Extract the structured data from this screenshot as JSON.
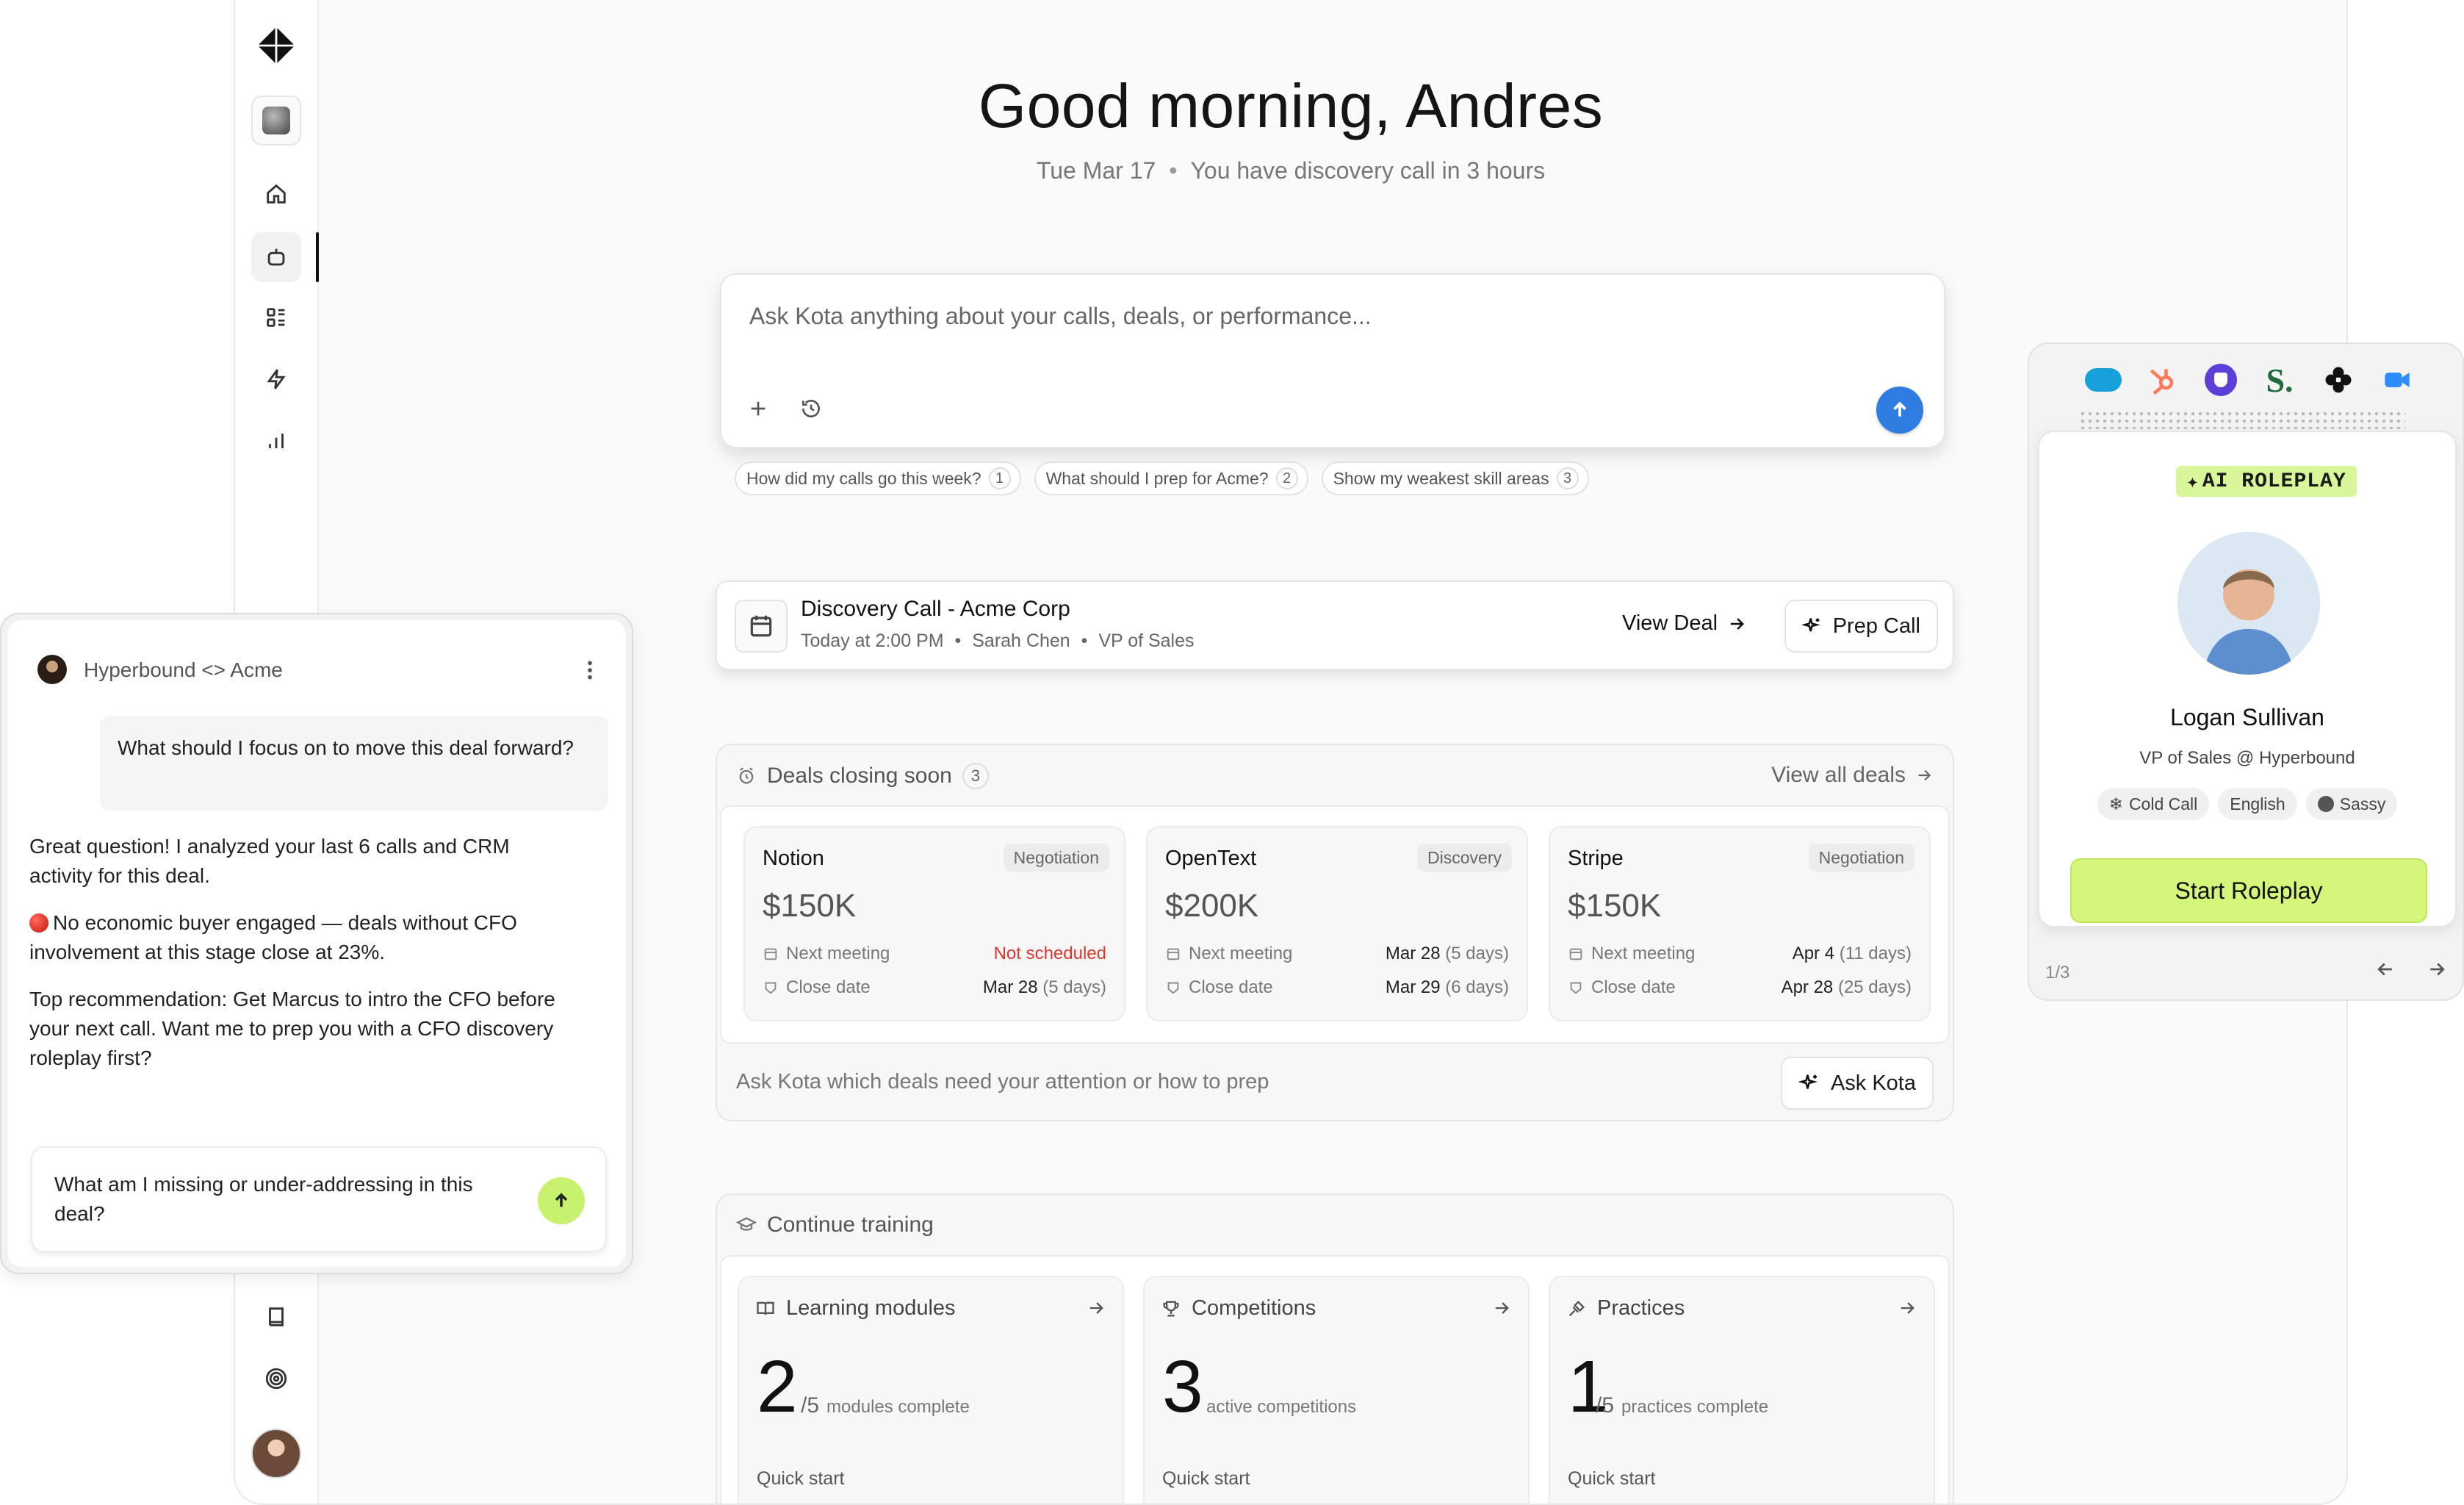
{
  "greeting": "Good morning, Andres",
  "subline": {
    "date": "Tue Mar 17",
    "note": "You have discovery call in 3 hours"
  },
  "ask": {
    "placeholder": "Ask Kota anything about your calls, deals, or performance..."
  },
  "suggestions": [
    {
      "label": "How did my calls go this week?",
      "num": "1"
    },
    {
      "label": "What should I prep for Acme?",
      "num": "2"
    },
    {
      "label": "Show my weakest skill areas",
      "num": "3"
    }
  ],
  "meeting": {
    "title": "Discovery Call - Acme Corp",
    "time": "Today at 2:00 PM",
    "person": "Sarah Chen",
    "role": "VP of Sales",
    "view_label": "View Deal",
    "prep_label": "Prep Call"
  },
  "deals": {
    "title": "Deals closing soon",
    "count": "3",
    "view_all": "View all deals",
    "footer": "Ask Kota which deals need your attention or how to prep",
    "ask_label": "Ask Kota",
    "next_label": "Next meeting",
    "close_label": "Close date",
    "items": [
      {
        "name": "Notion",
        "stage": "Negotiation",
        "amount": "$150K",
        "next": "Not scheduled",
        "next_rel": "",
        "close": "Mar 28",
        "close_rel": "(5 days)"
      },
      {
        "name": "OpenText",
        "stage": "Discovery",
        "amount": "$200K",
        "next": "Mar 28",
        "next_rel": "(5 days)",
        "close": "Mar 29",
        "close_rel": "(6 days)"
      },
      {
        "name": "Stripe",
        "stage": "Negotiation",
        "amount": "$150K",
        "next": "Apr 4",
        "next_rel": "(11 days)",
        "close": "Apr 28",
        "close_rel": "(25 days)"
      }
    ]
  },
  "training": {
    "title": "Continue training",
    "quick_start": "Quick start",
    "cards": [
      {
        "title": "Learning modules",
        "big": "2",
        "of": "/5",
        "desc": "modules complete"
      },
      {
        "title": "Competitions",
        "big": "3",
        "of": "",
        "desc": "active competitions"
      },
      {
        "title": "Practices",
        "big": "1",
        "of": "/5",
        "desc": "practices complete"
      }
    ]
  },
  "chat": {
    "title": "Hyperbound <> Acme",
    "user_msg": "What should I focus on to move this deal forward?",
    "ai_p1": "Great question! I analyzed your last 6 calls and CRM activity for this deal.",
    "ai_p2": "No economic buyer engaged — deals without CFO involvement at this stage close at 23%.",
    "ai_p3": "Top recommendation: Get Marcus to intro the CFO before your next call. Want me to prep you with a CFO discovery roleplay first?",
    "input_value": "What am I missing or under-addressing in this deal?"
  },
  "roleplay": {
    "badge": "AI ROLEPLAY",
    "name": "Logan Sullivan",
    "role": "VP of Sales @ Hyperbound",
    "tags": [
      "Cold Call",
      "English",
      "Sassy"
    ],
    "start_label": "Start Roleplay",
    "page": "1/3",
    "logos": [
      "salesforce-logo",
      "hubspot-logo",
      "shield-logo",
      "s-logo",
      "flower-logo",
      "zoom-logo"
    ]
  },
  "colors": {
    "accent": "#2f7de1",
    "lime": "#d4f67b",
    "danger": "#e0352b"
  }
}
